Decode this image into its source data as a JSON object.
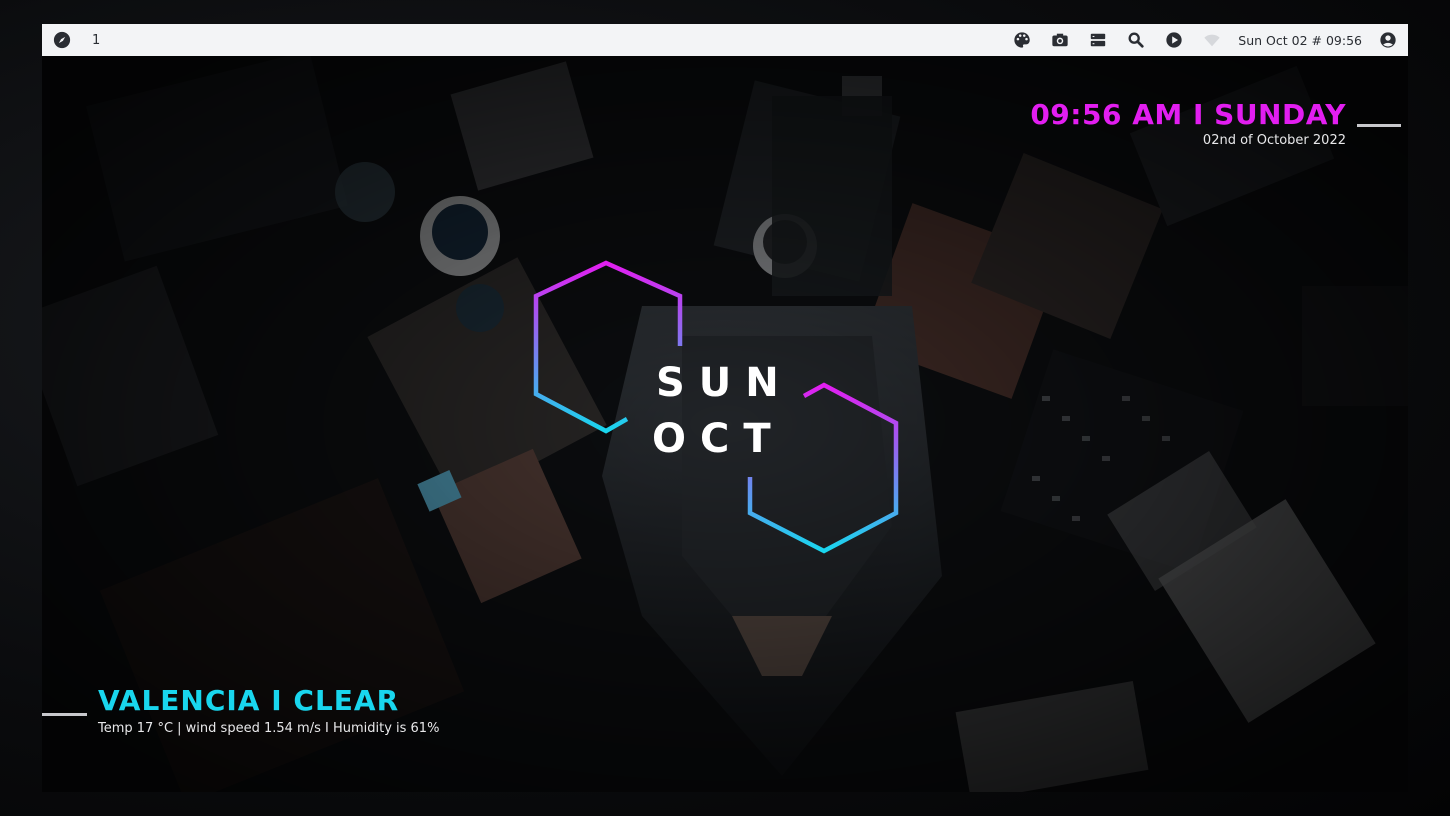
{
  "topbar": {
    "launcher_icon": "compass-icon",
    "workspace": "1",
    "tray_icons": [
      "palette-icon",
      "camera-icon",
      "server-icon",
      "search-icon",
      "play-icon",
      "wifi-icon"
    ],
    "clock": "Sun Oct 02 # 09:56",
    "user_icon": "user-circle-icon"
  },
  "datetime": {
    "time_day": "09:56 AM I SUNDAY",
    "full_date": "02nd of October 2022"
  },
  "center": {
    "day": "SUN",
    "month": "OCT"
  },
  "weather": {
    "title": "VALENCIA I CLEAR",
    "details": "Temp 17 °C | wind speed 1.54 m/s I Humidity is 61%"
  },
  "colors": {
    "magenta": "#e21ef0",
    "cyan": "#19d6ee",
    "bar_bg": "#f3f4f6"
  }
}
